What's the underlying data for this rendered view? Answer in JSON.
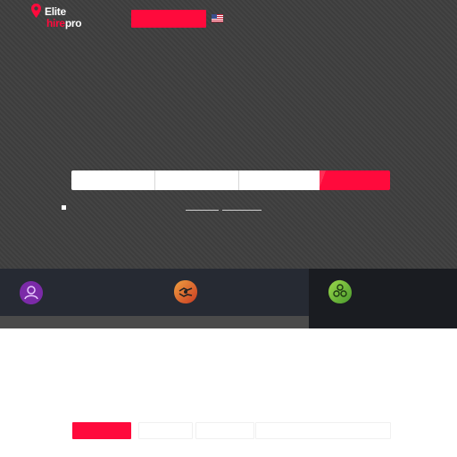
{
  "logo": {
    "line1": "Elite",
    "line2_accent": "hire",
    "line2": "pro"
  },
  "header": {
    "flag": "us-flag-icon"
  },
  "features": [
    {
      "icon": "user-icon",
      "color": "#7b2aa8"
    },
    {
      "icon": "handshake-icon",
      "color": "#e0552a"
    },
    {
      "icon": "team-icon",
      "color": "#6ab83a"
    }
  ],
  "colors": {
    "accent": "#ff0a3c",
    "hero": "#3f3f3f",
    "strip": "#262a33",
    "strip_active": "#1a1c21"
  }
}
